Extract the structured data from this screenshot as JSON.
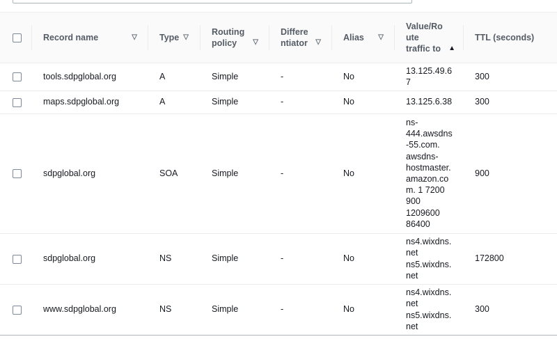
{
  "columns": {
    "record_name": "Record name",
    "type": "Type",
    "routing_policy": [
      "Routing",
      "policy"
    ],
    "differentiator": [
      "Differe",
      "ntiator"
    ],
    "alias": "Alias",
    "value": [
      "Value/Ro",
      "ute",
      "traffic to"
    ],
    "ttl": "TTL (seconds)"
  },
  "sort": {
    "column": "value",
    "direction": "ascending"
  },
  "rows": [
    {
      "name": "tools.sdpglobal.org",
      "type": "A",
      "routing": "Simple",
      "diff": "-",
      "alias": "No",
      "value": [
        "13.125.49.6",
        "7"
      ],
      "ttl": "300"
    },
    {
      "name": "maps.sdpglobal.org",
      "type": "A",
      "routing": "Simple",
      "diff": "-",
      "alias": "No",
      "value": [
        "13.125.6.38"
      ],
      "ttl": "300"
    },
    {
      "name": "sdpglobal.org",
      "type": "SOA",
      "routing": "Simple",
      "diff": "-",
      "alias": "No",
      "value": [
        "ns-",
        "444.awsdns",
        "-55.com.",
        "awsdns-",
        "hostmaster.",
        "amazon.co",
        "m. 1 7200",
        "900",
        "1209600",
        "86400"
      ],
      "ttl": "900"
    },
    {
      "name": "sdpglobal.org",
      "type": "NS",
      "routing": "Simple",
      "diff": "-",
      "alias": "No",
      "value": [
        "ns4.wixdns.",
        "net",
        "ns5.wixdns.",
        "net"
      ],
      "ttl": "172800"
    },
    {
      "name": "www.sdpglobal.org",
      "type": "NS",
      "routing": "Simple",
      "diff": "-",
      "alias": "No",
      "value": [
        "ns4.wixdns.",
        "net",
        "ns5.wixdns.",
        "net"
      ],
      "ttl": "300"
    }
  ]
}
